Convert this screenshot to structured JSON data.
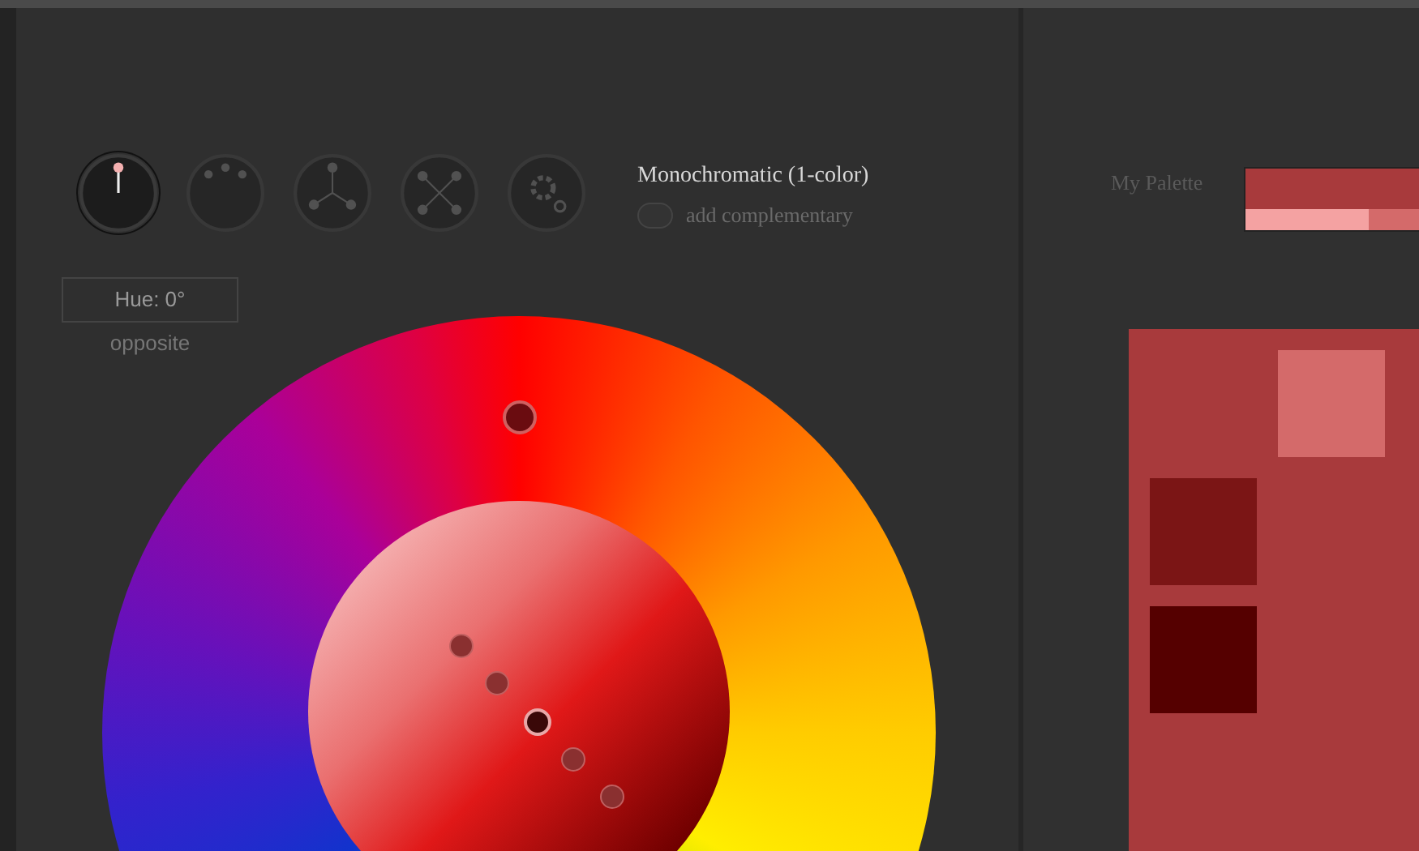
{
  "modes": [
    {
      "kind": "mono",
      "selected": true
    },
    {
      "kind": "analog",
      "selected": false
    },
    {
      "kind": "triad",
      "selected": false
    },
    {
      "kind": "tetrad",
      "selected": false
    },
    {
      "kind": "custom",
      "selected": false
    }
  ],
  "mode_title": "Monochromatic (1-color)",
  "complementary": {
    "label": "add complementary",
    "on": false
  },
  "hue": {
    "value": "Hue: 0°",
    "caption": "opposite"
  },
  "palette": {
    "label": "My Palette",
    "bar": [
      {
        "color": "#a83a3c"
      }
    ],
    "bar_shades": [
      {
        "color": "#f4a2a2"
      },
      {
        "color": "#d46a6a"
      }
    ]
  },
  "swatches": [
    {
      "color": "#d46a6a"
    },
    {
      "color": "#7b1515"
    },
    {
      "color": "#550000"
    }
  ],
  "main_swatch": {
    "color": "#a83a3c"
  }
}
